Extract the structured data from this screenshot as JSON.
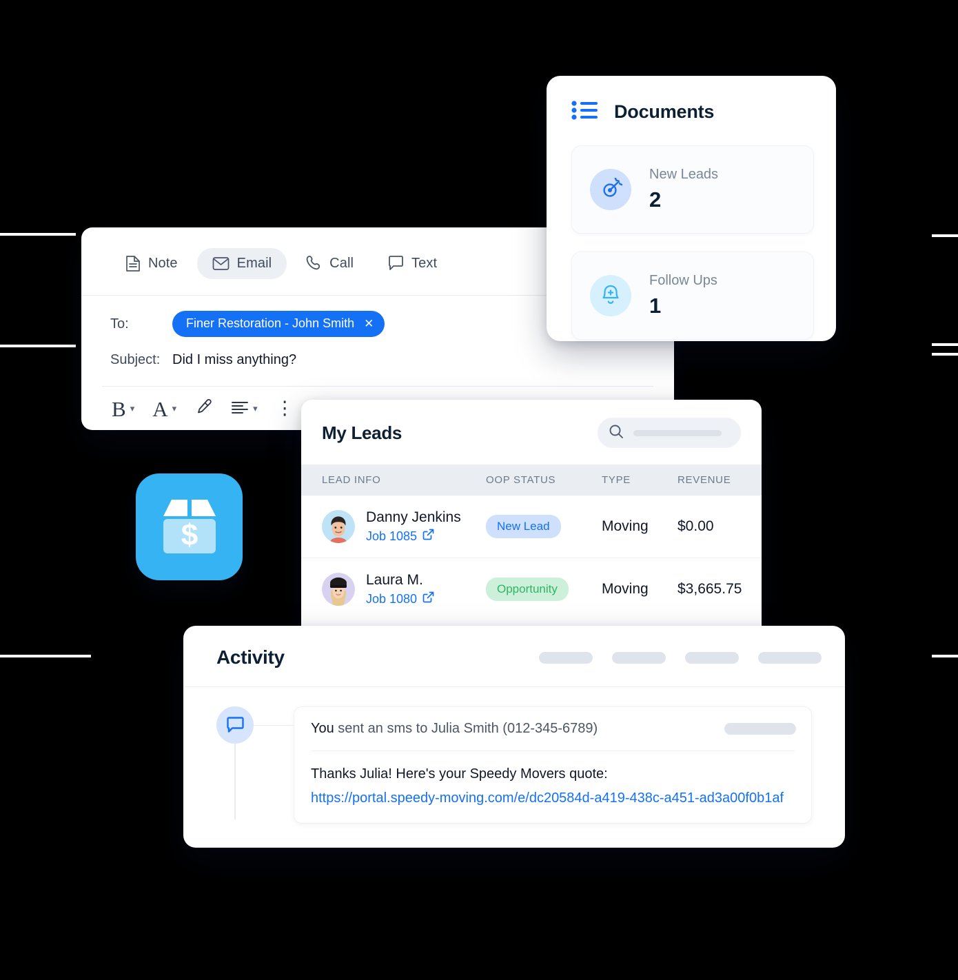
{
  "email_composer": {
    "tabs": [
      {
        "label": "Note",
        "icon": "note-icon",
        "active": false
      },
      {
        "label": "Email",
        "icon": "envelope-icon",
        "active": true
      },
      {
        "label": "Call",
        "icon": "phone-icon",
        "active": false
      },
      {
        "label": "Text",
        "icon": "chat-bubble-icon",
        "active": false
      }
    ],
    "send_button_icon": "open-envelope-icon",
    "to_label": "To:",
    "to_chip": "Finer Restoration - John Smith",
    "to_chip_remove": "✕",
    "subject_label": "Subject:",
    "subject_value": "Did I miss anything?",
    "format_tools": [
      {
        "name": "bold-tool",
        "glyph": "B",
        "has_caret": true
      },
      {
        "name": "font-tool",
        "glyph": "A",
        "has_caret": true
      },
      {
        "name": "highlighter-tool",
        "glyph": "",
        "has_caret": false
      },
      {
        "name": "align-tool",
        "glyph": "",
        "has_caret": true
      },
      {
        "name": "more-tool",
        "glyph": "⋮",
        "has_caret": false
      }
    ]
  },
  "documents": {
    "title": "Documents",
    "list_icon": "list-bullets-icon",
    "stats": [
      {
        "label": "New Leads",
        "value": "2",
        "icon": "target-icon",
        "icon_bg": "#cfe0fd",
        "icon_color": "#1f6fe8"
      },
      {
        "label": "Follow Ups",
        "value": "1",
        "icon": "bell-plus-icon",
        "icon_bg": "#d6f0fd",
        "icon_color": "#36b3f2"
      }
    ]
  },
  "leads": {
    "title": "My Leads",
    "search": {
      "icon": "search-icon",
      "placeholder": ""
    },
    "columns": [
      "LEAD INFO",
      "OOP STATUS",
      "TYPE",
      "REVENUE"
    ],
    "rows": [
      {
        "name": "Danny Jenkins",
        "job": "Job 1085",
        "job_icon": "external-link-icon",
        "status": "New Lead",
        "status_style": "new",
        "type": "Moving",
        "revenue": "$0.00",
        "avatar": "avatar-danny"
      },
      {
        "name": "Laura M.",
        "job": "Job 1080",
        "job_icon": "external-link-icon",
        "status": "Opportunity",
        "status_style": "opportunity",
        "type": "Moving",
        "revenue": "$3,665.75",
        "avatar": "avatar-laura"
      }
    ]
  },
  "activity": {
    "title": "Activity",
    "header_placeholders": [
      78,
      78,
      78,
      92
    ],
    "entry": {
      "icon": "chat-bubble-icon",
      "prefix": "You",
      "text": " sent an sms to Julia Smith (012-345-6789)",
      "timestamp_placeholder": true,
      "message": "Thanks Julia! Here's your Speedy Movers quote:",
      "url": "https://portal.speedy-moving.com/e/dc20584d-a419-438c-a451-ad3a00f0b1af"
    }
  },
  "app_icon": {
    "name": "moving-box-dollar-icon",
    "bg": "#36b3f2"
  },
  "colors": {
    "accent_blue": "#1471f5",
    "light_blue": "#36b3f2",
    "green": "#2fb463",
    "text_dark": "#101828",
    "text_muted": "#6c7a8a"
  }
}
